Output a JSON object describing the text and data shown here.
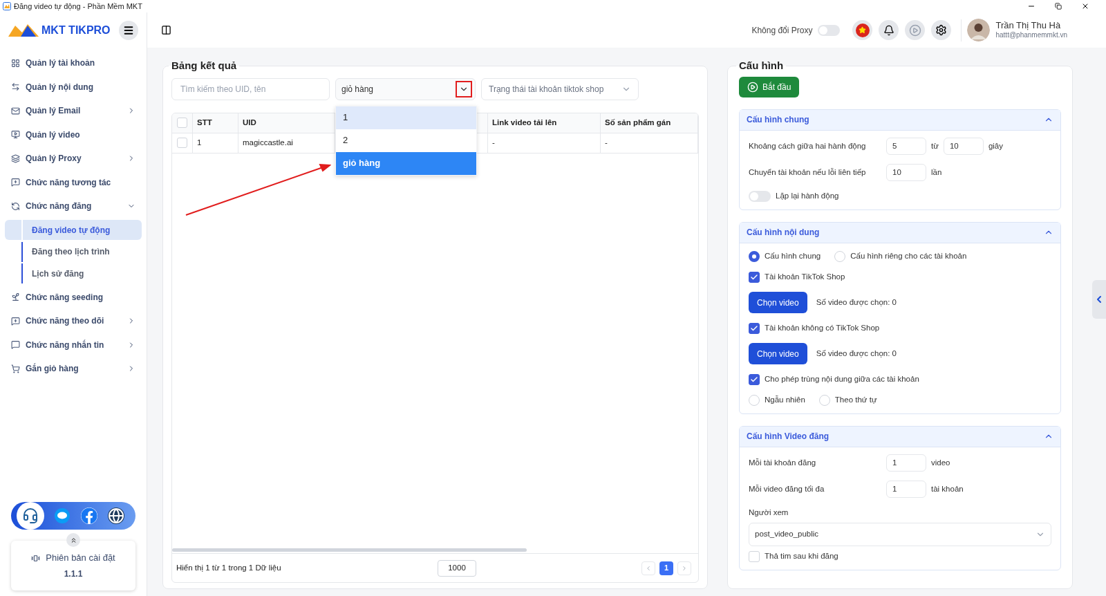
{
  "window": {
    "title": "Đăng video tự động - Phần Mềm MKT"
  },
  "sidebar": {
    "logo": "MKT TIKPRO",
    "items": [
      {
        "label": "Quản lý tài khoản",
        "kind": "link"
      },
      {
        "label": "Quản lý nội dung",
        "kind": "link"
      },
      {
        "label": "Quản lý Email",
        "kind": "group",
        "expanded": false
      },
      {
        "label": "Quản lý video",
        "kind": "link"
      },
      {
        "label": "Quản lý Proxy",
        "kind": "group",
        "expanded": false
      },
      {
        "label": "Chức năng tương tác",
        "kind": "link"
      },
      {
        "label": "Chức năng đăng",
        "kind": "group",
        "expanded": true,
        "children": [
          {
            "label": "Đăng video tự động",
            "selected": true
          },
          {
            "label": "Đăng theo lịch trình",
            "selected": false
          },
          {
            "label": "Lịch sử đăng",
            "selected": false
          }
        ]
      },
      {
        "label": "Chức năng seeding",
        "kind": "link"
      },
      {
        "label": "Chức năng theo dõi",
        "kind": "group",
        "expanded": false
      },
      {
        "label": "Chức năng nhắn tin",
        "kind": "group",
        "expanded": false
      },
      {
        "label": "Gắn giỏ hàng",
        "kind": "group",
        "expanded": false
      }
    ],
    "version": {
      "label": "Phiên bản cài đặt",
      "value": "1.1.1"
    }
  },
  "header": {
    "proxy_toggle": {
      "label": "Không đổi Proxy",
      "on": false
    },
    "user": {
      "name": "Trần Thị Thu Hà",
      "email": "hattt@phanmemmkt.vn"
    }
  },
  "results": {
    "title": "Bảng kết quả",
    "search": {
      "placeholder": "Tìm kiếm theo UID, tên"
    },
    "filter": {
      "value": "giỏ hàng",
      "open": true,
      "options": [
        {
          "label": "1",
          "hovered": true,
          "selected": false
        },
        {
          "label": "2",
          "hovered": false,
          "selected": false
        },
        {
          "label": "giỏ hàng",
          "hovered": false,
          "selected": true
        }
      ]
    },
    "status": {
      "placeholder": "Trạng thái tài khoản tiktok shop"
    },
    "table": {
      "all_checked": false,
      "columns": [
        "STT",
        "UID",
        "",
        "Link video tải lên",
        "Số sản phẩm gán"
      ],
      "rows": [
        {
          "checked": false,
          "cells": [
            "1",
            "magiccastle.ai",
            "",
            "-",
            "-"
          ]
        }
      ]
    },
    "footer": {
      "info": "Hiển thị 1 từ 1 trong 1 Dữ liệu",
      "page_size": "1000",
      "pages": [
        {
          "label": "1",
          "selected": true
        }
      ]
    }
  },
  "config": {
    "title": "Cấu hình",
    "start_button": "Bắt đầu",
    "sections": [
      {
        "title": "Cấu hình chung",
        "expanded": true,
        "rows": [
          {
            "kind": "numbers",
            "label": "Khoảng cách giữa hai hành động",
            "parts": [
              {
                "kind": "field",
                "text": "5"
              },
              {
                "kind": "text",
                "text": "từ"
              },
              {
                "kind": "field",
                "text": "10"
              },
              {
                "kind": "text",
                "text": "giây"
              }
            ]
          },
          {
            "kind": "numbers",
            "label": "Chuyển tài khoản nếu lỗi liên tiếp",
            "parts": [
              {
                "kind": "field",
                "text": "10"
              },
              {
                "kind": "text",
                "text": "lần"
              }
            ]
          },
          {
            "kind": "switch",
            "label": "Lặp lại hành động",
            "on": false
          }
        ]
      },
      {
        "title": "Cấu hình nội dung",
        "expanded": true,
        "rows": [
          {
            "kind": "radios",
            "options": [
              {
                "label": "Cấu hình chung",
                "selected": true
              },
              {
                "label": "Cấu hình riêng cho các tài khoản",
                "selected": false
              }
            ]
          },
          {
            "kind": "checkbox",
            "label": "Tài khoản TikTok Shop",
            "checked": true
          },
          {
            "kind": "picker",
            "button": "Chọn video",
            "text": "Số video được chọn: 0"
          },
          {
            "kind": "checkbox",
            "label": "Tài khoản không có TikTok Shop",
            "checked": true
          },
          {
            "kind": "picker",
            "button": "Chọn video",
            "text": "Số video được chọn: 0"
          },
          {
            "kind": "checkbox",
            "label": "Cho phép trùng nội dung giữa các tài khoản",
            "checked": true
          },
          {
            "kind": "radios",
            "options": [
              {
                "label": "Ngẫu nhiên",
                "selected": false
              },
              {
                "label": "Theo thứ tự",
                "selected": false
              }
            ]
          }
        ]
      },
      {
        "title": "Cấu hình Video đăng",
        "expanded": true,
        "rows": [
          {
            "kind": "numbers",
            "label": "Mỗi tài khoản đăng",
            "parts": [
              {
                "kind": "field",
                "text": "1"
              },
              {
                "kind": "text",
                "text": "video"
              }
            ]
          },
          {
            "kind": "numbers",
            "label": "Mỗi video đăng tối đa",
            "parts": [
              {
                "kind": "field",
                "text": "1"
              },
              {
                "kind": "text",
                "text": "tài khoản"
              }
            ]
          },
          {
            "kind": "select",
            "label": "Người xem",
            "value": "post_video_public"
          },
          {
            "kind": "checkbox",
            "label": "Thả tim sau khi đăng",
            "checked": false
          }
        ]
      }
    ]
  }
}
